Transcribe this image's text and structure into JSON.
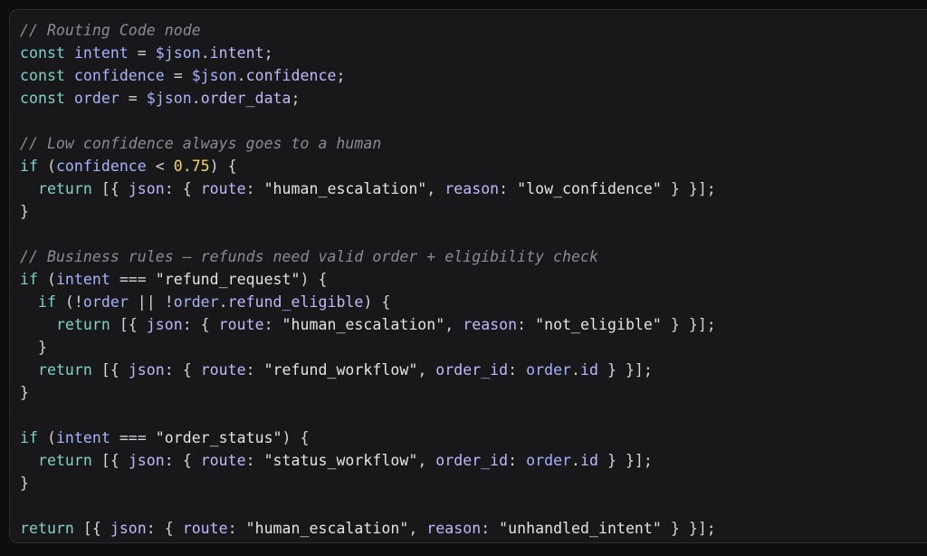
{
  "editor": {
    "language": "javascript",
    "colors": {
      "background": "#18181b",
      "border": "#2c2c31",
      "comment": "#8b8b94",
      "keyword": "#7dd3c8",
      "identifier": "#a5b4fc",
      "property": "#c4b5fd",
      "string": "#e4e4e7",
      "number": "#fcd34d",
      "punctuation": "#d4d4d8"
    },
    "lines": [
      [
        {
          "t": "comment",
          "v": "// Routing Code node"
        }
      ],
      [
        {
          "t": "keyword",
          "v": "const"
        },
        {
          "t": "punct",
          "v": " "
        },
        {
          "t": "ident",
          "v": "intent"
        },
        {
          "t": "punct",
          "v": " = "
        },
        {
          "t": "ident",
          "v": "$json"
        },
        {
          "t": "punct",
          "v": "."
        },
        {
          "t": "prop",
          "v": "intent"
        },
        {
          "t": "punct",
          "v": ";"
        }
      ],
      [
        {
          "t": "keyword",
          "v": "const"
        },
        {
          "t": "punct",
          "v": " "
        },
        {
          "t": "ident",
          "v": "confidence"
        },
        {
          "t": "punct",
          "v": " = "
        },
        {
          "t": "ident",
          "v": "$json"
        },
        {
          "t": "punct",
          "v": "."
        },
        {
          "t": "prop",
          "v": "confidence"
        },
        {
          "t": "punct",
          "v": ";"
        }
      ],
      [
        {
          "t": "keyword",
          "v": "const"
        },
        {
          "t": "punct",
          "v": " "
        },
        {
          "t": "ident",
          "v": "order"
        },
        {
          "t": "punct",
          "v": " = "
        },
        {
          "t": "ident",
          "v": "$json"
        },
        {
          "t": "punct",
          "v": "."
        },
        {
          "t": "prop",
          "v": "order_data"
        },
        {
          "t": "punct",
          "v": ";"
        }
      ],
      [],
      [
        {
          "t": "comment",
          "v": "// Low confidence always goes to a human"
        }
      ],
      [
        {
          "t": "keyword",
          "v": "if"
        },
        {
          "t": "punct",
          "v": " ("
        },
        {
          "t": "ident",
          "v": "confidence"
        },
        {
          "t": "punct",
          "v": " < "
        },
        {
          "t": "number",
          "v": "0.75"
        },
        {
          "t": "punct",
          "v": ") {"
        }
      ],
      [
        {
          "t": "punct",
          "v": "  "
        },
        {
          "t": "keyword",
          "v": "return"
        },
        {
          "t": "punct",
          "v": " [{ "
        },
        {
          "t": "prop",
          "v": "json"
        },
        {
          "t": "punct",
          "v": ": { "
        },
        {
          "t": "prop",
          "v": "route"
        },
        {
          "t": "punct",
          "v": ": "
        },
        {
          "t": "string",
          "v": "\"human_escalation\""
        },
        {
          "t": "punct",
          "v": ", "
        },
        {
          "t": "prop",
          "v": "reason"
        },
        {
          "t": "punct",
          "v": ": "
        },
        {
          "t": "string",
          "v": "\"low_confidence\""
        },
        {
          "t": "punct",
          "v": " } }];"
        }
      ],
      [
        {
          "t": "punct",
          "v": "}"
        }
      ],
      [],
      [
        {
          "t": "comment",
          "v": "// Business rules — refunds need valid order + eligibility check"
        }
      ],
      [
        {
          "t": "keyword",
          "v": "if"
        },
        {
          "t": "punct",
          "v": " ("
        },
        {
          "t": "ident",
          "v": "intent"
        },
        {
          "t": "punct",
          "v": " === "
        },
        {
          "t": "string",
          "v": "\"refund_request\""
        },
        {
          "t": "punct",
          "v": ") {"
        }
      ],
      [
        {
          "t": "punct",
          "v": "  "
        },
        {
          "t": "keyword",
          "v": "if"
        },
        {
          "t": "punct",
          "v": " (!"
        },
        {
          "t": "ident",
          "v": "order"
        },
        {
          "t": "punct",
          "v": " || !"
        },
        {
          "t": "ident",
          "v": "order"
        },
        {
          "t": "punct",
          "v": "."
        },
        {
          "t": "prop",
          "v": "refund_eligible"
        },
        {
          "t": "punct",
          "v": ") {"
        }
      ],
      [
        {
          "t": "punct",
          "v": "    "
        },
        {
          "t": "keyword",
          "v": "return"
        },
        {
          "t": "punct",
          "v": " [{ "
        },
        {
          "t": "prop",
          "v": "json"
        },
        {
          "t": "punct",
          "v": ": { "
        },
        {
          "t": "prop",
          "v": "route"
        },
        {
          "t": "punct",
          "v": ": "
        },
        {
          "t": "string",
          "v": "\"human_escalation\""
        },
        {
          "t": "punct",
          "v": ", "
        },
        {
          "t": "prop",
          "v": "reason"
        },
        {
          "t": "punct",
          "v": ": "
        },
        {
          "t": "string",
          "v": "\"not_eligible\""
        },
        {
          "t": "punct",
          "v": " } }];"
        }
      ],
      [
        {
          "t": "punct",
          "v": "  }"
        }
      ],
      [
        {
          "t": "punct",
          "v": "  "
        },
        {
          "t": "keyword",
          "v": "return"
        },
        {
          "t": "punct",
          "v": " [{ "
        },
        {
          "t": "prop",
          "v": "json"
        },
        {
          "t": "punct",
          "v": ": { "
        },
        {
          "t": "prop",
          "v": "route"
        },
        {
          "t": "punct",
          "v": ": "
        },
        {
          "t": "string",
          "v": "\"refund_workflow\""
        },
        {
          "t": "punct",
          "v": ", "
        },
        {
          "t": "prop",
          "v": "order_id"
        },
        {
          "t": "punct",
          "v": ": "
        },
        {
          "t": "ident",
          "v": "order"
        },
        {
          "t": "punct",
          "v": "."
        },
        {
          "t": "prop",
          "v": "id"
        },
        {
          "t": "punct",
          "v": " } }];"
        }
      ],
      [
        {
          "t": "punct",
          "v": "}"
        }
      ],
      [],
      [
        {
          "t": "keyword",
          "v": "if"
        },
        {
          "t": "punct",
          "v": " ("
        },
        {
          "t": "ident",
          "v": "intent"
        },
        {
          "t": "punct",
          "v": " === "
        },
        {
          "t": "string",
          "v": "\"order_status\""
        },
        {
          "t": "punct",
          "v": ") {"
        }
      ],
      [
        {
          "t": "punct",
          "v": "  "
        },
        {
          "t": "keyword",
          "v": "return"
        },
        {
          "t": "punct",
          "v": " [{ "
        },
        {
          "t": "prop",
          "v": "json"
        },
        {
          "t": "punct",
          "v": ": { "
        },
        {
          "t": "prop",
          "v": "route"
        },
        {
          "t": "punct",
          "v": ": "
        },
        {
          "t": "string",
          "v": "\"status_workflow\""
        },
        {
          "t": "punct",
          "v": ", "
        },
        {
          "t": "prop",
          "v": "order_id"
        },
        {
          "t": "punct",
          "v": ": "
        },
        {
          "t": "ident",
          "v": "order"
        },
        {
          "t": "punct",
          "v": "."
        },
        {
          "t": "prop",
          "v": "id"
        },
        {
          "t": "punct",
          "v": " } }];"
        }
      ],
      [
        {
          "t": "punct",
          "v": "}"
        }
      ],
      [],
      [
        {
          "t": "keyword",
          "v": "return"
        },
        {
          "t": "punct",
          "v": " [{ "
        },
        {
          "t": "prop",
          "v": "json"
        },
        {
          "t": "punct",
          "v": ": { "
        },
        {
          "t": "prop",
          "v": "route"
        },
        {
          "t": "punct",
          "v": ": "
        },
        {
          "t": "string",
          "v": "\"human_escalation\""
        },
        {
          "t": "punct",
          "v": ", "
        },
        {
          "t": "prop",
          "v": "reason"
        },
        {
          "t": "punct",
          "v": ": "
        },
        {
          "t": "string",
          "v": "\"unhandled_intent\""
        },
        {
          "t": "punct",
          "v": " } }];"
        }
      ]
    ]
  }
}
